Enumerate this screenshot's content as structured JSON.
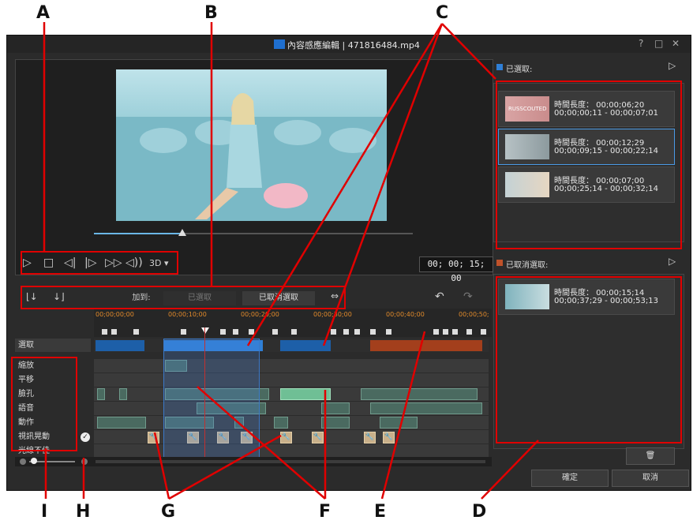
{
  "callouts": {
    "a": "A",
    "b": "B",
    "c": "C",
    "d": "D",
    "e": "E",
    "f": "F",
    "g": "G",
    "h": "H",
    "i": "I"
  },
  "window": {
    "title": "內容感應編輯 | 471816484.mp4",
    "help": "?",
    "maximize": "□",
    "close": "✕"
  },
  "player": {
    "mode_3d": "3D",
    "timecode": "00; 00; 15; 00"
  },
  "toolbar": {
    "add_to_label": "加到:",
    "selected_btn": "已選取",
    "deselected_btn": "已取消選取"
  },
  "ruler": {
    "labels": [
      "00;00;00;00",
      "00;00;10;00",
      "00;00;20;00",
      "00;00;30;00",
      "00;00;40;00",
      "00;00;50;"
    ]
  },
  "tracks": {
    "selected": "選取",
    "zoom": "縮放",
    "pan": "平移",
    "face": "臉孔",
    "speech": "語音",
    "motion": "動作",
    "shaky": "視訊晃動",
    "poor_light": "光線不佳"
  },
  "right_panel": {
    "selected_header": "已選取:",
    "deselected_header": "已取消選取:",
    "selected_items": [
      {
        "duration": "時間長度： 00;00;06;20",
        "range": "00;00;00;11 - 00;00;07;01",
        "thumb_text": "RUSSCOUTED"
      },
      {
        "duration": "時間長度： 00;00;12;29",
        "range": "00;00;09;15 - 00;00;22;14",
        "thumb_text": ""
      },
      {
        "duration": "時間長度： 00;00;07;00",
        "range": "00;00;25;14 - 00;00;32;14",
        "thumb_text": ""
      }
    ],
    "deselected_items": [
      {
        "duration": "時間長度： 00;00;15;14",
        "range": "00;00;37;29 - 00;00;53;13"
      }
    ]
  },
  "footer": {
    "ok": "確定",
    "cancel": "取消"
  },
  "colors": {
    "accent_blue": "#2f7fd6",
    "selection_orange": "#c0522a",
    "annotation_red": "#e00000"
  }
}
